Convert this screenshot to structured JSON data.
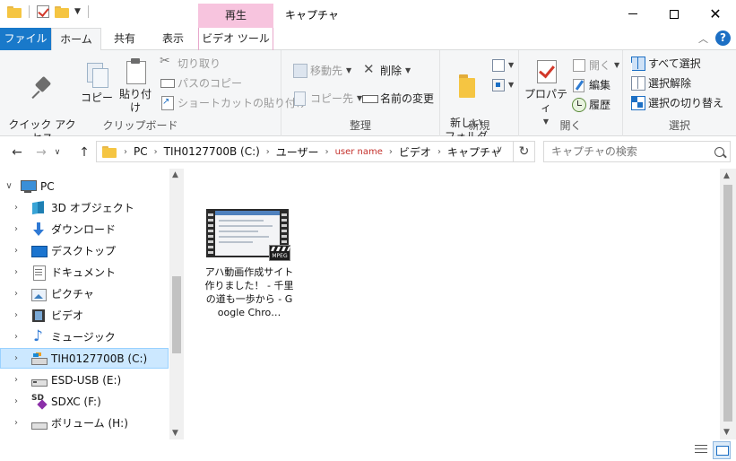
{
  "window": {
    "title": "キャプチャ",
    "context_tab_header": "再生",
    "close_glyph": "✕"
  },
  "ribbon_tabs": {
    "file": "ファイル",
    "home": "ホーム",
    "share": "共有",
    "view": "表示",
    "video_tools": "ビデオ ツール"
  },
  "clipboard": {
    "pin": "クイック アクセス\nにピン留めする",
    "copy": "コピー",
    "paste": "貼り付け",
    "cut": "切り取り",
    "copy_path": "パスのコピー",
    "paste_shortcut": "ショートカットの貼り付け",
    "group_label": "クリップボード"
  },
  "organize": {
    "move_to": "移動先",
    "copy_to": "コピー先",
    "delete": "削除",
    "rename": "名前の変更",
    "group_label": "整理"
  },
  "new": {
    "new_folder": "新しい\nフォルダー",
    "group_label": "新規"
  },
  "open": {
    "properties": "プロパティ",
    "open": "開く",
    "edit": "編集",
    "history": "履歴",
    "group_label": "開く"
  },
  "select": {
    "select_all": "すべて選択",
    "select_none": "選択解除",
    "invert": "選択の切り替え",
    "group_label": "選択"
  },
  "address": {
    "crumbs": [
      "PC",
      "TIH0127700B (C:)",
      "ユーザー",
      "user name",
      "ビデオ",
      "キャプチャ"
    ],
    "search_placeholder": "キャプチャの検索"
  },
  "nav_tree": {
    "root": "PC",
    "items": [
      {
        "label": "3D オブジェクト",
        "icon": "3d-objects-icon"
      },
      {
        "label": "ダウンロード",
        "icon": "download-icon"
      },
      {
        "label": "デスクトップ",
        "icon": "desktop-icon"
      },
      {
        "label": "ドキュメント",
        "icon": "documents-icon"
      },
      {
        "label": "ピクチャ",
        "icon": "pictures-icon"
      },
      {
        "label": "ビデオ",
        "icon": "videos-icon"
      },
      {
        "label": "ミュージック",
        "icon": "music-icon"
      },
      {
        "label": "TIH0127700B (C:)",
        "icon": "drive-icon",
        "selected": true
      },
      {
        "label": "ESD-USB (E:)",
        "icon": "usb-drive-icon"
      },
      {
        "label": "SDXC (F:)",
        "icon": "sd-card-icon"
      },
      {
        "label": "ボリューム (H:)",
        "icon": "volume-drive-icon"
      }
    ]
  },
  "files": [
    {
      "name": "アハ動画作成サイト作りました！ - 千里の道も一歩から - Google Chro…",
      "badge": "MPEG",
      "icon": "video-file-icon"
    }
  ],
  "colors": {
    "file_tab": "#1979ca",
    "context_tab": "#f7c4de",
    "selection": "#cce8ff",
    "user_crumb": "#c4302b"
  }
}
